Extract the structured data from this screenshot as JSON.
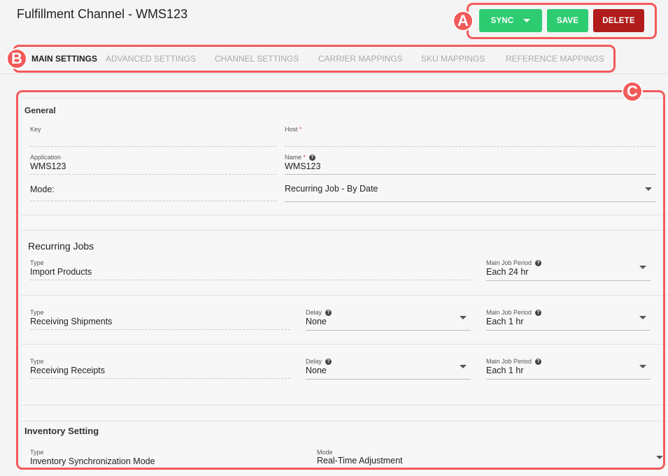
{
  "header": {
    "title": "Fulfillment Channel - WMS123"
  },
  "actions": {
    "sync_label": "SYNC",
    "save_label": "SAVE",
    "delete_label": "DELETE"
  },
  "annotations": {
    "a": "A",
    "b": "B",
    "c": "C",
    "color": "#f25a5a"
  },
  "tabs": [
    {
      "label": "MAIN SETTINGS",
      "active": true
    },
    {
      "label": "ADVANCED SETTINGS"
    },
    {
      "label": "CHANNEL SETTINGS"
    },
    {
      "label": "CARRIER MAPPINGS"
    },
    {
      "label": "SKU MAPPINGS"
    },
    {
      "label": "REFERENCE MAPPINGS"
    }
  ],
  "general": {
    "title": "General",
    "key_label": "Key",
    "host_label": "Host",
    "required_mark": "*",
    "application_label": "Application",
    "application_value": "WMS123",
    "name_label": "Name",
    "name_value": "WMS123",
    "mode_label": "Mode:",
    "mode_value": "Recurring Job - By Date"
  },
  "recurring": {
    "title": "Recurring Jobs",
    "jobs": [
      {
        "type_label": "Type",
        "type_value": "Import Products",
        "period_label": "Main Job Period",
        "period_value": "Each 24 hr"
      },
      {
        "type_label": "Type",
        "type_value": "Receiving Shipments",
        "delay_label": "Delay",
        "delay_value": "None",
        "period_label": "Main Job Period",
        "period_value": "Each 1 hr"
      },
      {
        "type_label": "Type",
        "type_value": "Receiving Receipts",
        "delay_label": "Delay",
        "delay_value": "None",
        "period_label": "Main Job Period",
        "period_value": "Each 1 hr"
      }
    ]
  },
  "inventory": {
    "title": "Inventory Setting",
    "type_label": "Type",
    "type_value": "Inventory Synchronization Mode",
    "mode_label": "Mode",
    "mode_value": "Real-Time Adjustment"
  },
  "colors": {
    "green": "#2ecc71",
    "red": "#b01c1c"
  },
  "icons": {
    "help": "help-circle-icon",
    "dropdown": "chevron-down-icon",
    "sync_caret": "caret-down-icon"
  }
}
